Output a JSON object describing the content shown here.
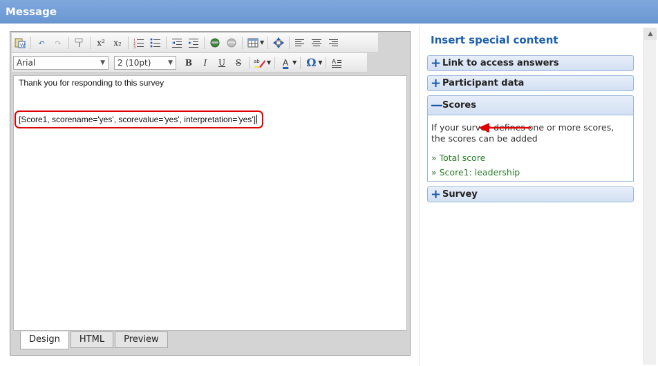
{
  "window": {
    "title": "Message"
  },
  "editor": {
    "font_select": "Arial",
    "size_select": "2 (10pt)",
    "content": {
      "line1": "Thank you for responding to this survey",
      "placeholder": "[Score1, scorename='yes', scorevalue='yes', interpretation='yes']"
    },
    "tabs": [
      "Design",
      "HTML",
      "Preview"
    ],
    "active_tab": "Design"
  },
  "toolbar": {
    "superscript": "x²",
    "subscript": "x₂",
    "bold": "B",
    "italic": "I",
    "underline": "U",
    "strike": "S",
    "font_color": "A",
    "omega": "Ω"
  },
  "sidebar": {
    "title": "Insert special content",
    "sections": [
      {
        "label": "Link to access answers",
        "expanded": false,
        "symbol": "+"
      },
      {
        "label": "Participant data",
        "expanded": false,
        "symbol": "+"
      },
      {
        "label": "Scores",
        "expanded": true,
        "symbol": "—"
      },
      {
        "label": "Survey",
        "expanded": false,
        "symbol": "+"
      }
    ],
    "scores": {
      "description": "If your survey defines one or more scores, the scores can be added",
      "links": [
        "» Total score",
        "» Score1: leadership"
      ]
    }
  },
  "colors": {
    "titlebar": "#6a97d2",
    "accent_blue": "#1b5fae",
    "link_green": "#2a7d2a",
    "highlight_red": "#e00000"
  }
}
